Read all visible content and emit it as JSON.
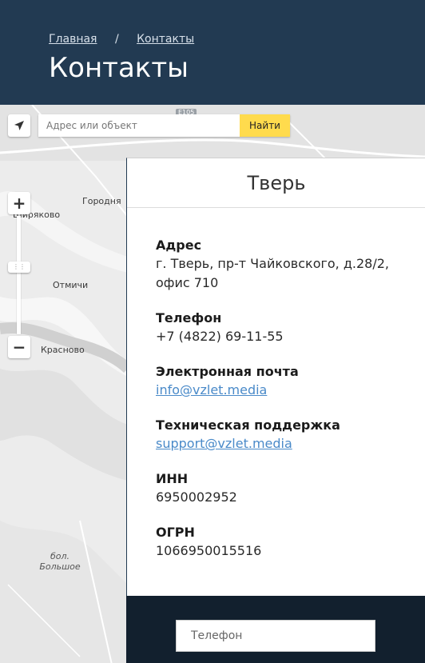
{
  "breadcrumb": {
    "home": "Главная",
    "separator": "/",
    "current": "Контакты"
  },
  "page_title": "Контакты",
  "map": {
    "search_placeholder": "Адрес или объект",
    "search_button": "Найти",
    "labels": {
      "gorodnya": "Городня",
      "shiryakovo": "Ширяково",
      "otmichi": "Отмичи",
      "krasnovo": "Красново",
      "bolshoe_line1": "бол.",
      "bolshoe_line2": "Большое"
    },
    "road_badge": "E105",
    "icons": {
      "geolocation": "arrow-icon",
      "zoom_in": "plus-icon",
      "zoom_out": "minus-icon"
    }
  },
  "card": {
    "title": "Тверь",
    "address_label": "Адрес",
    "address_value": "г. Тверь, пр-т Чайковского, д.28/2, офис 710",
    "phone_label": "Телефон",
    "phone_value": "+7 (4822) 69-11-55",
    "email_label": "Электронная почта",
    "email_value": "info@vzlet.media",
    "support_label": "Техническая поддержка",
    "support_value": "support@vzlet.media",
    "inn_label": "ИНН",
    "inn_value": "6950002952",
    "ogrn_label": "ОГРН",
    "ogrn_value": "1066950015516"
  },
  "form": {
    "phone_placeholder": "Телефон"
  },
  "colors": {
    "header_bg": "#223a52",
    "footer_bg": "#12202e",
    "link": "#4a8ac9",
    "search_button": "#ffdb4d"
  }
}
